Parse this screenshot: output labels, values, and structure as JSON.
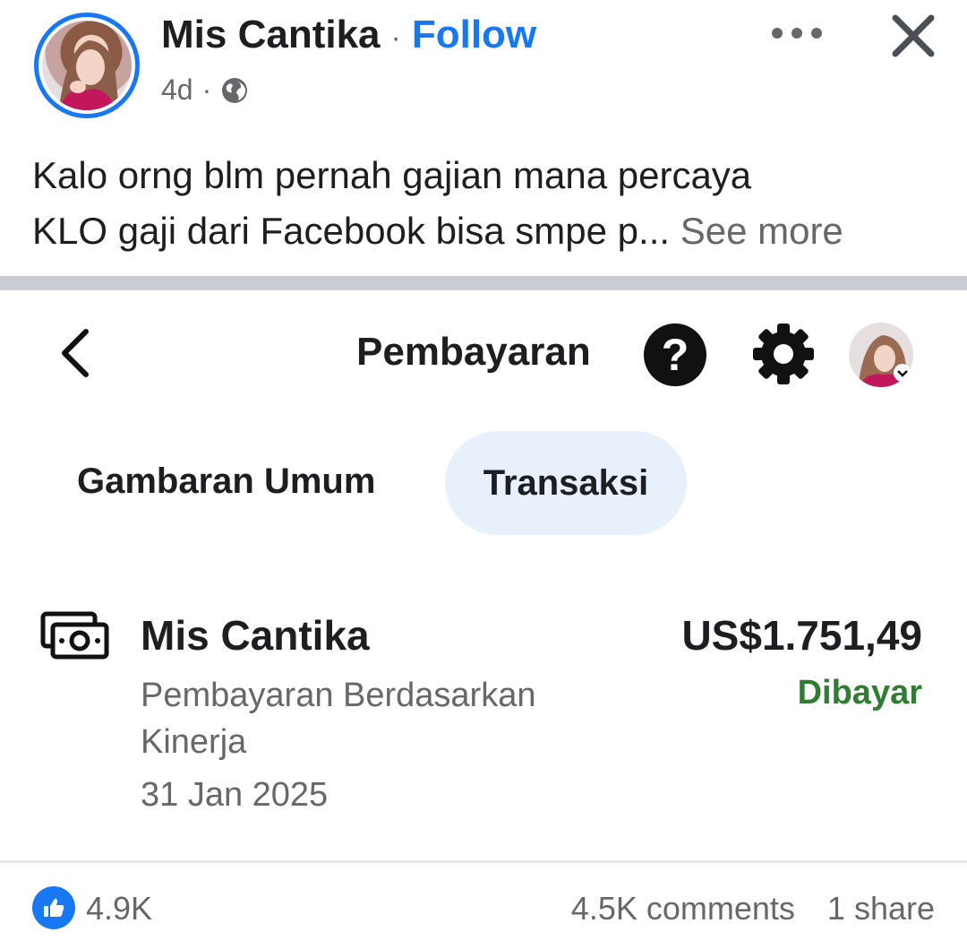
{
  "post": {
    "author": "Mis Cantika",
    "separator": "·",
    "follow_label": "Follow",
    "time": "4d",
    "meta_separator": "·",
    "privacy_icon": "globe-icon",
    "more_icon": "more-horizontal-icon",
    "close_icon": "close-icon",
    "caption_line1": "Kalo orng blm pernah gajian mana percaya",
    "caption_line2": "KLO gaji dari Facebook bisa smpe p...",
    "see_more_label": "See more"
  },
  "payments_screen": {
    "back_icon": "chevron-left-icon",
    "title": "Pembayaran",
    "help_icon": "question-icon",
    "help_glyph": "?",
    "settings_icon": "gear-icon",
    "tabs": [
      {
        "label": "Gambaran Umum",
        "selected": false
      },
      {
        "label": "Transaksi",
        "selected": true
      }
    ],
    "transaction": {
      "icon": "money-icon",
      "name": "Mis Cantika",
      "description": "Pembayaran Berdasarkan Kinerja",
      "date": "31 Jan 2025",
      "amount": "US$1.751,49",
      "status": "Dibayar"
    }
  },
  "engagement": {
    "like_icon": "thumbs-up-icon",
    "likes": "4.9K",
    "comments": "4.5K comments",
    "shares": "1 share"
  },
  "colors": {
    "brand_blue": "#1877f2",
    "status_green": "#2e7d32",
    "selected_tab_bg": "#e7f0fb",
    "secondary_text": "#65676b"
  }
}
